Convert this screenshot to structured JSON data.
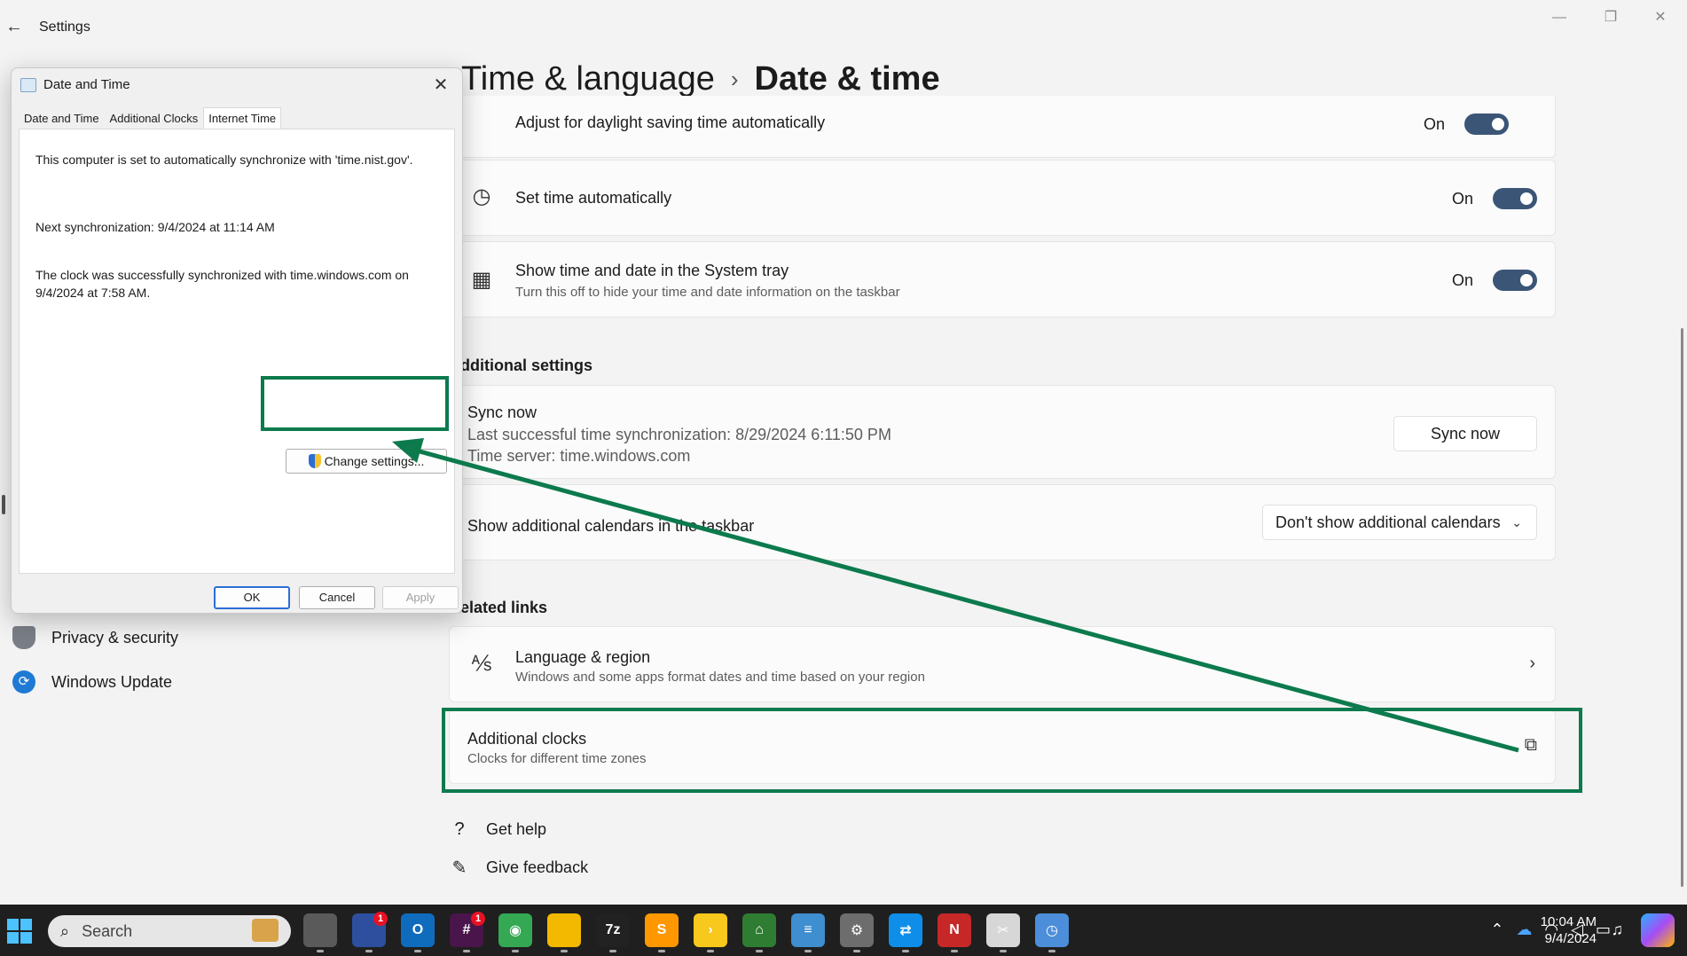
{
  "window": {
    "title": "Settings",
    "back_glyph": "←",
    "minimize_glyph": "—",
    "restore_glyph": "❐",
    "close_glyph": "✕"
  },
  "header": {
    "parent": "Time & language",
    "separator": "›",
    "current": "Date & time"
  },
  "settings": {
    "daylight": {
      "label": "Adjust for daylight saving time automatically",
      "state": "On"
    },
    "set_time_auto": {
      "label": "Set time automatically",
      "state": "On",
      "icon": "clock-icon"
    },
    "show_tray": {
      "label": "Show time and date in the System tray",
      "description": "Turn this off to hide your time and date information on the taskbar",
      "state": "On",
      "icon": "calendar-clock-icon"
    }
  },
  "additional_settings": {
    "heading": "Additional settings",
    "sync": {
      "title": "Sync now",
      "last_sync": "Last successful time synchronization: 8/29/2024 6:11:50 PM",
      "server": "Time server: time.windows.com",
      "button": "Sync now"
    },
    "calendars": {
      "label": "Show additional calendars in the taskbar",
      "selected": "Don't show additional calendars"
    }
  },
  "related_links": {
    "heading": "Related links",
    "language_region": {
      "title": "Language & region",
      "description": "Windows and some apps format dates and time based on your region"
    },
    "additional_clocks": {
      "title": "Additional clocks",
      "description": "Clocks for different time zones"
    }
  },
  "help": {
    "get_help": "Get help",
    "give_feedback": "Give feedback"
  },
  "sidebar": {
    "items": [
      {
        "label": "Privacy & security",
        "icon": "shield-icon",
        "color": "#7a7f87"
      },
      {
        "label": "Windows Update",
        "icon": "update-icon",
        "color": "#1f7ad3"
      }
    ]
  },
  "dialog": {
    "title": "Date and Time",
    "close_glyph": "✕",
    "tabs": [
      "Date and Time",
      "Additional Clocks",
      "Internet Time"
    ],
    "active_tab": "Internet Time",
    "auto_sync_text": "This computer is set to automatically synchronize with 'time.nist.gov'.",
    "next_sync_text": "Next synchronization: 9/4/2024 at 11:14 AM",
    "last_sync_text": "The clock was successfully synchronized with time.windows.com on 9/4/2024 at 7:58 AM.",
    "change_button": "Change settings...",
    "ok": "OK",
    "cancel": "Cancel",
    "apply": "Apply"
  },
  "annotation": {
    "color": "#0c7a4d"
  },
  "taskbar": {
    "search_placeholder": "Search",
    "apps": [
      {
        "name": "task-view-icon",
        "color": "#5a5a5a",
        "glyph": ""
      },
      {
        "name": "thermometer-app-icon",
        "color": "#2d4f9e",
        "glyph": "",
        "badge": "1"
      },
      {
        "name": "outlook-icon",
        "color": "#0f6cbd",
        "glyph": "O"
      },
      {
        "name": "slack-icon",
        "color": "#4a154b",
        "glyph": "#",
        "badge": "1"
      },
      {
        "name": "chrome-icon",
        "color": "#34a853",
        "glyph": "◉"
      },
      {
        "name": "file-explorer-icon",
        "color": "#f2b900",
        "glyph": ""
      },
      {
        "name": "7zip-icon",
        "color": "#222222",
        "glyph": "7z"
      },
      {
        "name": "sublime-icon",
        "color": "#ff9800",
        "glyph": "S"
      },
      {
        "name": "power-automate-icon",
        "color": "#f8c81c",
        "glyph": "›"
      },
      {
        "name": "maps-app-icon",
        "color": "#2e7d32",
        "glyph": "⌂"
      },
      {
        "name": "notepad-icon",
        "color": "#3e8ed0",
        "glyph": "≡"
      },
      {
        "name": "settings-gear-icon",
        "color": "#6d6d6d",
        "glyph": "⚙"
      },
      {
        "name": "teamviewer-icon",
        "color": "#0e8ee9",
        "glyph": "⇄"
      },
      {
        "name": "red-app-icon",
        "color": "#c62828",
        "glyph": "N"
      },
      {
        "name": "snipping-tool-icon",
        "color": "#d7d7d7",
        "glyph": "✂"
      },
      {
        "name": "date-time-app-icon",
        "color": "#4c8ed9",
        "glyph": "◷"
      }
    ],
    "time": "10:04 AM",
    "date": "9/4/2024"
  }
}
